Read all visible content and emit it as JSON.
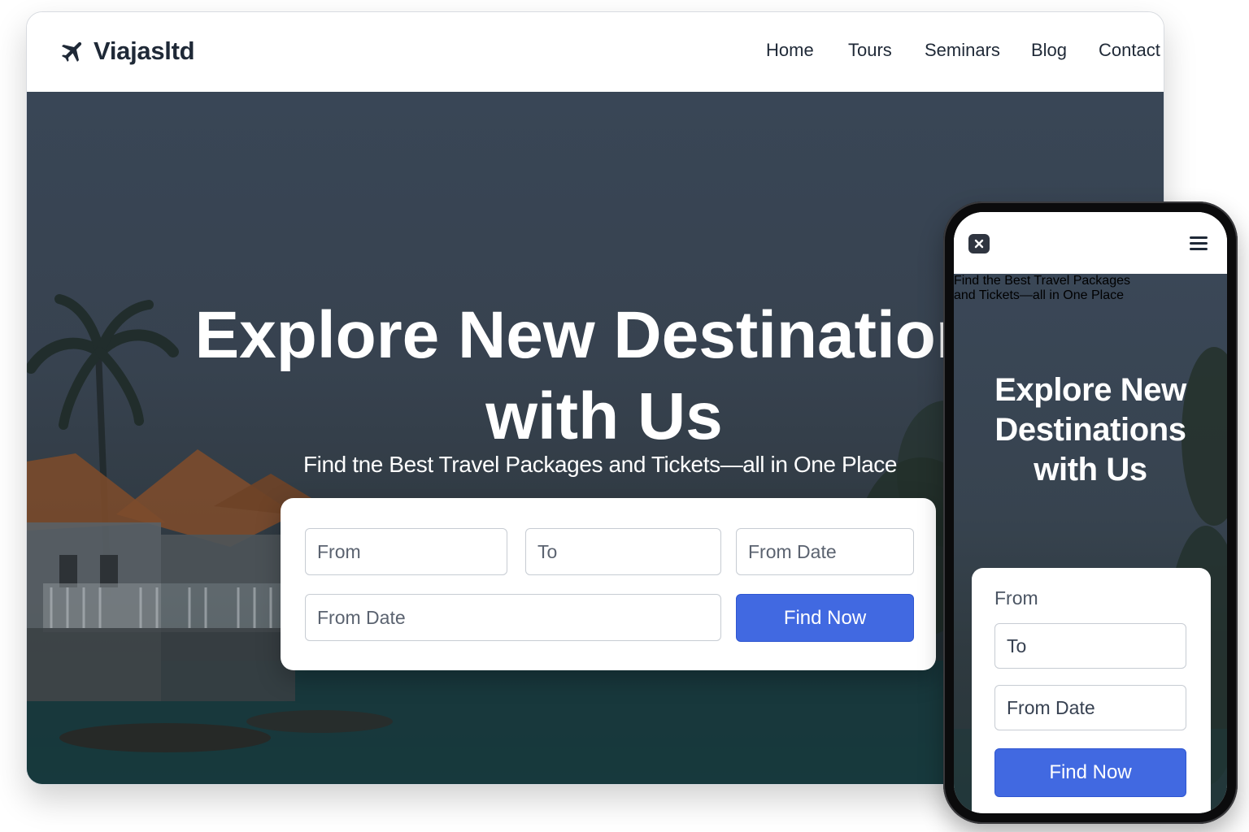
{
  "brand": {
    "name": "Viajasltd",
    "logo_icon": "airplane-icon"
  },
  "nav": {
    "items": [
      {
        "label": "Home"
      },
      {
        "label": "Tours"
      },
      {
        "label": "Seminars"
      },
      {
        "label": "Blog"
      },
      {
        "label": "Contact"
      }
    ]
  },
  "hero": {
    "title_line1": "Explore New Destinations",
    "title_line2": "with Us",
    "subtitle": "Find tne Best Travel Packages and Tickets—all in One Place"
  },
  "search": {
    "from_placeholder": "From",
    "to_placeholder": "To",
    "from_date_placeholder": "From Date",
    "from_date_2_placeholder": "From Date",
    "button_label": "Find Now"
  },
  "mobile": {
    "close_icon": "close-icon",
    "menu_icon": "hamburger-menu-icon",
    "title_line1": "Explore New",
    "title_line2": "Destinations",
    "title_line3": "with Us",
    "subtitle_line1": "Find the Best Travel Packages",
    "subtitle_line2": "and Tickets—all in One Place",
    "from_label": "From",
    "to_placeholder": "To",
    "from_date_placeholder": "From Date",
    "button_label": "Find Now"
  },
  "colors": {
    "accent": "#4169e1",
    "hero_overlay": "#394656",
    "text_dark": "#1f2937"
  }
}
